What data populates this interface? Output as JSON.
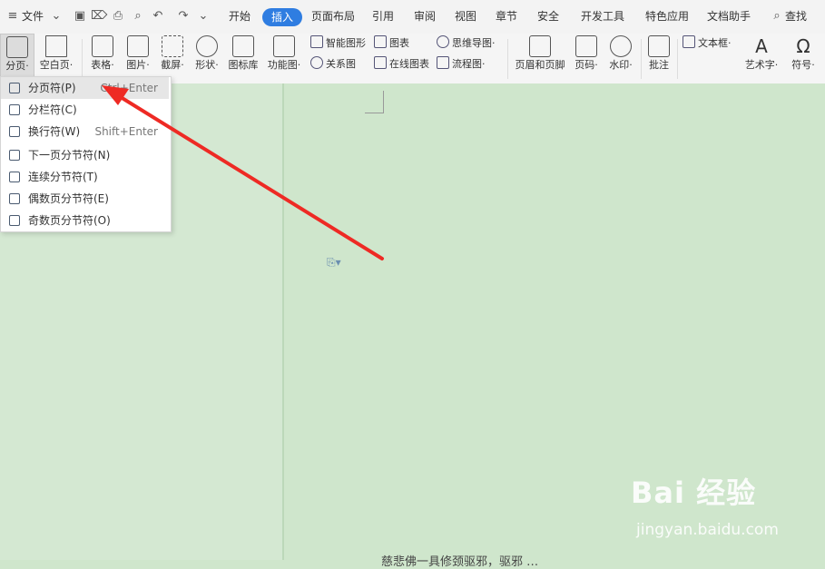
{
  "menubar": {
    "menu_label": "文件",
    "tabs": [
      {
        "label": "开始"
      },
      {
        "label": "插入"
      },
      {
        "label": "页面布局"
      },
      {
        "label": "引用"
      },
      {
        "label": "审阅"
      },
      {
        "label": "视图"
      },
      {
        "label": "章节"
      },
      {
        "label": "安全"
      },
      {
        "label": "开发工具"
      },
      {
        "label": "特色应用"
      },
      {
        "label": "文档助手"
      }
    ],
    "search_label": "查找",
    "active_tab_color": "#2f7de1"
  },
  "ribbon": {
    "page_break": "分页·",
    "blank_page": "空白页·",
    "table": "表格·",
    "picture": "图片·",
    "screenshot": "截屏·",
    "shape": "形状·",
    "icon_lib": "图标库",
    "func_chart": "功能图·",
    "smart_shape": "智能图形",
    "chart": "图表",
    "relation_chart": "关系图",
    "online_chart": "在线图表",
    "mind_map": "思维导图·",
    "flow_chart": "流程图·",
    "header_footer": "页眉和页脚",
    "page_number": "页码·",
    "watermark": "水印·",
    "comment": "批注",
    "text_box": "文本框·",
    "art_text": "艺术字·",
    "symbol": "符号·"
  },
  "dropdown": {
    "items": [
      {
        "label": "分页符(P)",
        "shortcut": "Ctrl+Enter"
      },
      {
        "label": "分栏符(C)",
        "shortcut": ""
      },
      {
        "label": "换行符(W)",
        "shortcut": "Shift+Enter"
      },
      {
        "label": "下一页分节符(N)",
        "shortcut": ""
      },
      {
        "label": "连续分节符(T)",
        "shortcut": ""
      },
      {
        "label": "偶数页分节符(E)",
        "shortcut": ""
      },
      {
        "label": "奇数页分节符(O)",
        "shortcut": ""
      }
    ]
  },
  "watermark": {
    "logo": "Bai 经验",
    "url": "jingyan.baidu.com"
  },
  "document": {
    "bottom_text": "慈悲佛一具修颈驱邪，驱邪 …"
  },
  "colors": {
    "arrow": "#ee2a24",
    "background": "#cfe6cc"
  }
}
